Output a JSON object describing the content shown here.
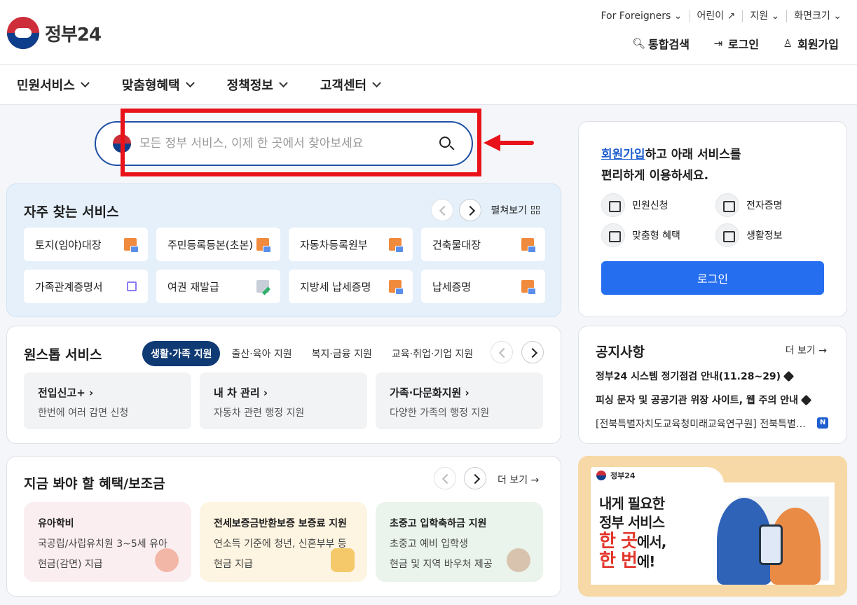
{
  "header": {
    "logo_text": "정부24",
    "util_links": [
      "For Foreigners",
      "어린이",
      "지원",
      "화면크기"
    ],
    "buttons": {
      "search": "통합검색",
      "login": "로그인",
      "signup": "회원가입"
    }
  },
  "gnb": [
    "민원서비스",
    "맞춤형혜택",
    "정책정보",
    "고객센터"
  ],
  "search": {
    "placeholder": "모든 정부 서비스, 이제 한 곳에서 찾아보세요"
  },
  "frequent": {
    "title": "자주 찾는 서비스",
    "expand": "펼쳐보기",
    "items": [
      {
        "label": "토지(임야)대장",
        "icon": "document-icon"
      },
      {
        "label": "주민등록등본(초본)",
        "icon": "document-icon"
      },
      {
        "label": "자동차등록원부",
        "icon": "document-icon"
      },
      {
        "label": "건축물대장",
        "icon": "document-icon"
      },
      {
        "label": "가족관계증명서",
        "icon": "external-link-icon"
      },
      {
        "label": "여권 재발급",
        "icon": "edit-icon"
      },
      {
        "label": "지방세 납세증명",
        "icon": "document-icon"
      },
      {
        "label": "납세증명",
        "icon": "document-icon"
      }
    ]
  },
  "onestop": {
    "title": "원스톱 서비스",
    "tabs": [
      "생활·가족 지원",
      "출산·육아 지원",
      "복지·금융 지원",
      "교육·취업·기업 지원"
    ],
    "cards": [
      {
        "title": "전입신고+",
        "desc": "한번에 여러 감면 신청"
      },
      {
        "title": "내 차 관리",
        "desc": "자동차 관련 행정 지원"
      },
      {
        "title": "가족·다문화지원",
        "desc": "다양한 가족의 행정 지원"
      }
    ]
  },
  "benefits": {
    "title": "지금 봐야 할 혜택/보조금",
    "more": "더 보기",
    "cards": [
      {
        "title": "유아학비",
        "line1": "국공립/사립유치원 3~5세 유아",
        "line2": "현금(감면) 지급",
        "bg": "#fbeef0"
      },
      {
        "title": "전세보증금반환보증 보증료 지원",
        "line1": "연소득 기준에 청년, 신혼부부 등",
        "line2": "현금 지급",
        "bg": "#fdf4e1"
      },
      {
        "title": "초중고 입학축하금 지원",
        "line1": "초중고 예비 입학생",
        "line2": "현금 및 지역 바우처 제공",
        "bg": "#eaf4ec"
      }
    ]
  },
  "login_box": {
    "msg_link": "회원가입",
    "msg_rest": "하고 아래 서비스를",
    "msg_line2": "편리하게 이용하세요.",
    "services": [
      "민원신청",
      "전자증명",
      "맞춤형 혜택",
      "생활정보"
    ],
    "button": "로그인"
  },
  "notice": {
    "title": "공지사항",
    "more": "더 보기",
    "items": [
      "정부24 시스템 정기점검 안내(11.28~29)",
      "피싱 문자 및 공공기관 위장 사이트, 웹 주의 안내",
      "[전북특별자치도교육청미래교육연구원] 전북특별…"
    ],
    "new_badge": "N"
  },
  "banner": {
    "mini_logo": "정부24",
    "line1": "내게 필요한",
    "line2": "정부 서비스",
    "line3a": "한 곳",
    "line3b": "에서,",
    "line4a": "한 번",
    "line4b": "에!"
  },
  "colors": {
    "primary": "#256ef0",
    "navy": "#0f3a73",
    "annotation_red": "#e9121a"
  }
}
